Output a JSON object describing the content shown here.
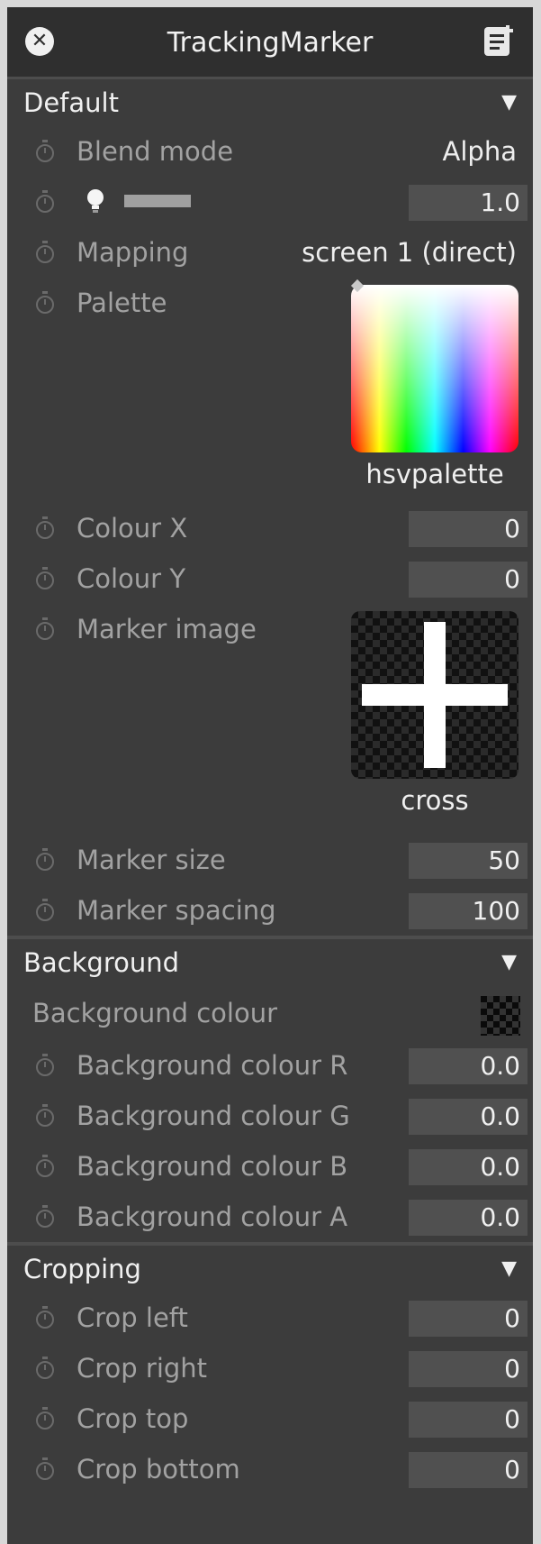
{
  "window": {
    "title": "TrackingMarker"
  },
  "sections": {
    "default": {
      "label": "Default",
      "blend_mode": {
        "label": "Blend mode",
        "value": "Alpha"
      },
      "opacity": {
        "value": "1.0"
      },
      "mapping": {
        "label": "Mapping",
        "value": "screen 1 (direct)"
      },
      "palette": {
        "label": "Palette",
        "value": "hsvpalette"
      },
      "colour_x": {
        "label": "Colour X",
        "value": "0"
      },
      "colour_y": {
        "label": "Colour Y",
        "value": "0"
      },
      "marker_image": {
        "label": "Marker image",
        "value": "cross"
      },
      "marker_size": {
        "label": "Marker size",
        "value": "50"
      },
      "marker_spacing": {
        "label": "Marker spacing",
        "value": "100"
      }
    },
    "background": {
      "label": "Background",
      "colour": {
        "label": "Background colour"
      },
      "r": {
        "label": "Background colour R",
        "value": "0.0"
      },
      "g": {
        "label": "Background colour G",
        "value": "0.0"
      },
      "b": {
        "label": "Background colour B",
        "value": "0.0"
      },
      "a": {
        "label": "Background colour A",
        "value": "0.0"
      }
    },
    "cropping": {
      "label": "Cropping",
      "left": {
        "label": "Crop left",
        "value": "0"
      },
      "right": {
        "label": "Crop right",
        "value": "0"
      },
      "top": {
        "label": "Crop top",
        "value": "0"
      },
      "bottom": {
        "label": "Crop bottom",
        "value": "0"
      }
    }
  },
  "icons": {
    "close": "close-icon",
    "notes": "notes-icon",
    "timer": "stopwatch-icon",
    "bulb": "lightbulb-icon",
    "collapse": "triangle-down-icon"
  },
  "colors": {
    "panel_bg": "#3c3c3c",
    "title_bg": "#2f2f2f",
    "field_bg": "#505050",
    "label_text": "#a2a2a2",
    "value_text": "#f0f0f0"
  }
}
